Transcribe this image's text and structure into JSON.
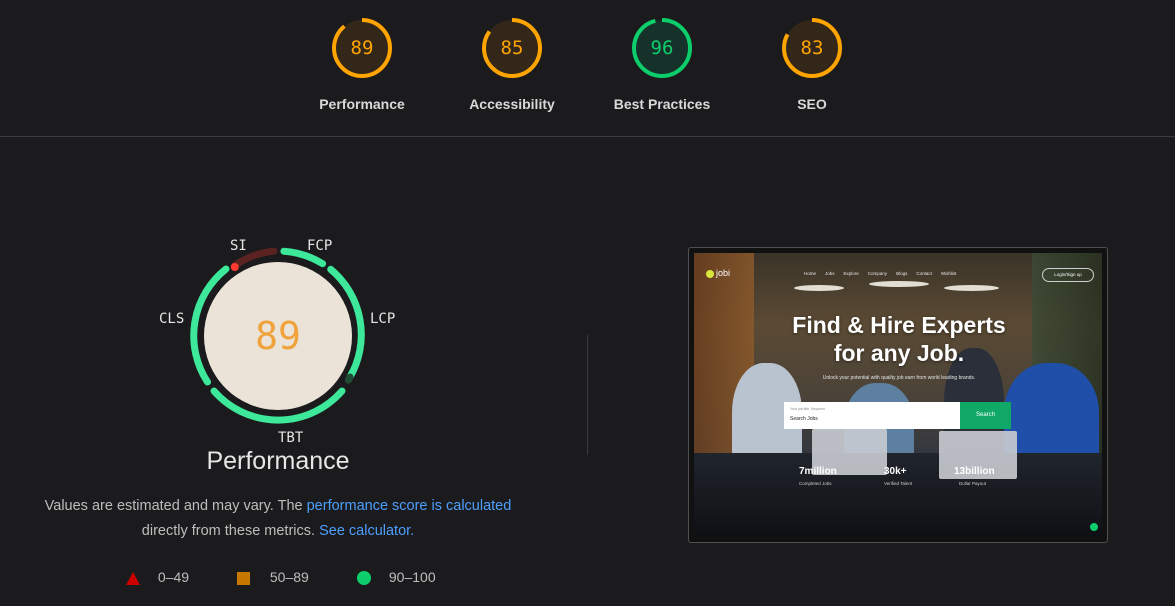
{
  "colors": {
    "good": "#0cce6b",
    "average": "#ffa400",
    "poor": "#ff4e42",
    "link": "#4c9ffe"
  },
  "categories": [
    {
      "label": "Performance",
      "score": 89,
      "status": "average"
    },
    {
      "label": "Accessibility",
      "score": 85,
      "status": "average"
    },
    {
      "label": "Best Practices",
      "score": 96,
      "status": "good"
    },
    {
      "label": "SEO",
      "score": 83,
      "status": "average"
    }
  ],
  "performance": {
    "score": "89",
    "title": "Performance",
    "metrics": {
      "si": "SI",
      "fcp": "FCP",
      "lcp": "LCP",
      "tbt": "TBT",
      "cls": "CLS"
    },
    "description": {
      "pre": "Values are estimated and may vary. The ",
      "link1": "performance score is calculated",
      "mid": "directly from these metrics.",
      "link2": "See calculator."
    },
    "legend": [
      {
        "range": "0–49",
        "icon": "triangle-icon"
      },
      {
        "range": "50–89",
        "icon": "square-icon"
      },
      {
        "range": "90–100",
        "icon": "circle-icon"
      }
    ]
  },
  "screenshot": {
    "logo": "jobi",
    "nav": [
      "Home",
      "Jobs",
      "Explore",
      "Company",
      "Blogs",
      "Contact",
      "Wishlist"
    ],
    "login": "Login/Sign up",
    "hero_title_1": "Find & Hire Experts",
    "hero_title_2": "for any Job.",
    "hero_sub": "Unlock your potential with quality job earn from world leading brands.",
    "search_label": "Your job title, Keyword",
    "search_value": "Search Jobs",
    "search_button": "Search",
    "stats": [
      {
        "value": "7million",
        "label": "Completed Jobs"
      },
      {
        "value": "30k+",
        "label": "Verified Talent"
      },
      {
        "value": "13billion",
        "label": "Dollar Payout"
      }
    ]
  }
}
